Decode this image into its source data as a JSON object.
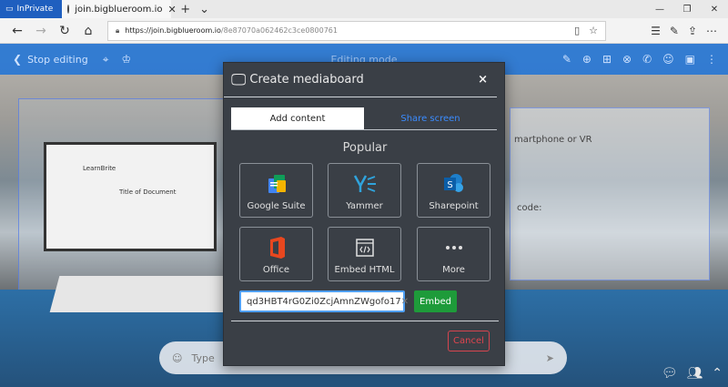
{
  "browser": {
    "inprivate_label": "InPrivate",
    "tab_title": "join.bigblueroom.io",
    "url_host": "https://join.bigblueroom.io",
    "url_path": "/8e87070a062462c3ce0800761"
  },
  "app": {
    "back_label": "Stop editing",
    "mode_label": "Editing mode"
  },
  "chat": {
    "placeholder": "Type"
  },
  "modal": {
    "title": "Create mediaboard",
    "close": "×",
    "tabs": [
      {
        "label": "Add content",
        "active": true
      },
      {
        "label": "Share screen",
        "active": false
      }
    ],
    "section": "Popular",
    "tiles": [
      {
        "label": "Google Suite",
        "icon": "google-suite-icon"
      },
      {
        "label": "Yammer",
        "icon": "yammer-icon"
      },
      {
        "label": "Sharepoint",
        "icon": "sharepoint-icon"
      },
      {
        "label": "Office",
        "icon": "office-icon"
      },
      {
        "label": "Embed HTML",
        "icon": "embed-html-icon"
      },
      {
        "label": "More",
        "icon": "more-icon"
      }
    ],
    "embed_value": "qd3HBT4rG0Zi0ZcjAmnZWgofo17",
    "embed_button": "Embed",
    "cancel_button": "Cancel"
  },
  "scene_text": {
    "doc_title": "Title of Document",
    "doc_brand": "LearnBrite",
    "right_text_1": "martphone or VR",
    "right_text_2": "code:"
  },
  "colors": {
    "accent": "#2174d6",
    "embed_green": "#1e9b3a",
    "cancel_red": "#d6454f",
    "modal_bg": "#3a3f46"
  }
}
